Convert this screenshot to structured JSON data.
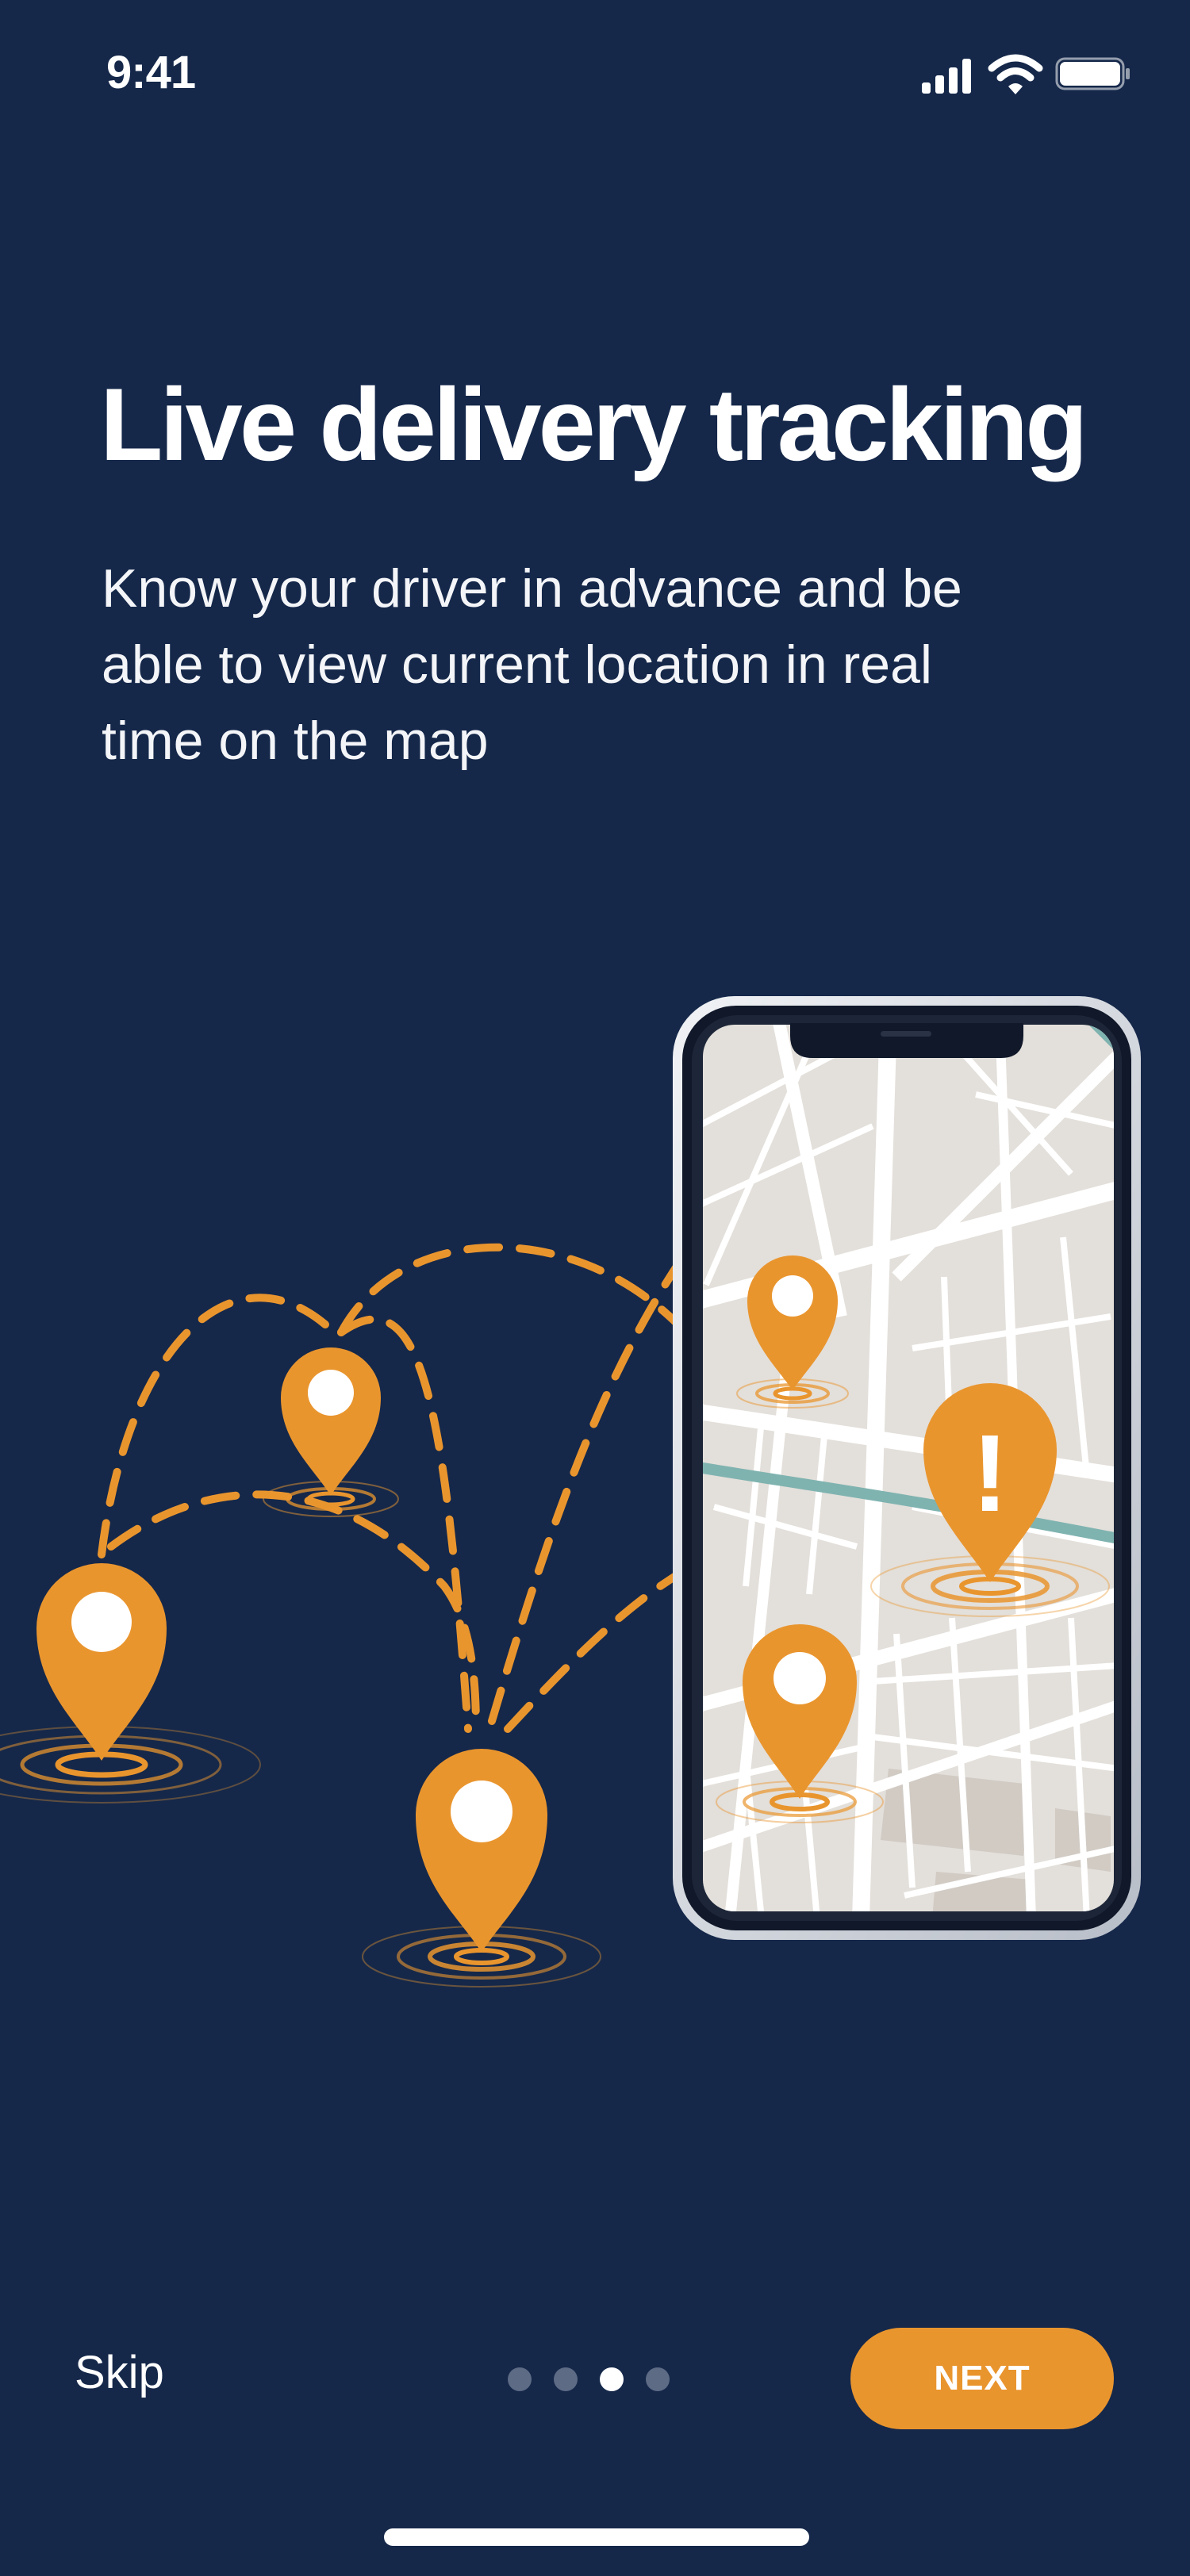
{
  "status_bar": {
    "time": "9:41",
    "icons": [
      "cellular-signal-icon",
      "wifi-icon",
      "battery-icon"
    ]
  },
  "onboarding": {
    "title": "Live delivery tracking",
    "subtitle": "Know your driver in advance and be able to view current location in real time on the map"
  },
  "illustration": {
    "elements": [
      "map-pin-icon",
      "map-pin-icon",
      "map-pin-icon",
      "map-pin-icon",
      "map-pin-icon",
      "map-alert-pin-icon",
      "smartphone-icon",
      "city-map"
    ],
    "alert_symbol": "!"
  },
  "footer": {
    "skip_label": "Skip",
    "next_label": "NEXT",
    "pager": {
      "total": 4,
      "current": 3
    }
  },
  "colors": {
    "background": "#15284a",
    "accent": "#e9952e",
    "map_background": "#e3dfda",
    "map_roads": "#ffffff",
    "river": "#7fb3b0",
    "inactive_dot": "#5d6b85"
  }
}
